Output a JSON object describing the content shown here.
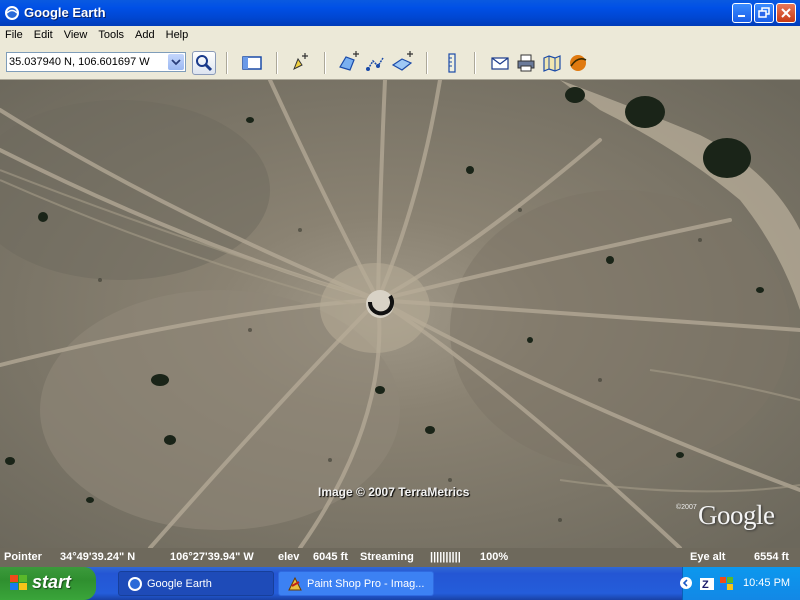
{
  "window": {
    "title": "Google Earth"
  },
  "menu": {
    "items": [
      "File",
      "Edit",
      "View",
      "Tools",
      "Add",
      "Help"
    ]
  },
  "toolbar": {
    "coordinates_value": "35.037940 N, 106.601697 W",
    "icons": [
      "search-icon",
      "sidebar-toggle-icon",
      "placemark-icon",
      "polygon-icon",
      "path-icon",
      "image-overlay-icon",
      "ruler-icon",
      "email-icon",
      "print-icon",
      "google-maps-icon",
      "sky-icon"
    ]
  },
  "map": {
    "credit": "Image © 2007 TerraMetrics",
    "logo_copyright": "©2007",
    "logo": "Google"
  },
  "status_bar": {
    "pointer_label": "Pointer",
    "latitude": "34°49'39.24\" N",
    "longitude": "106°27'39.94\" W",
    "elev_label": "elev",
    "elevation": "6045 ft",
    "streaming_label": "Streaming",
    "streaming_bar": "||||||||||",
    "streaming_percent": "100%",
    "eye_alt_label": "Eye alt",
    "eye_alt_value": "6554 ft"
  },
  "taskbar": {
    "start_label": "start",
    "tasks": [
      {
        "label": "Google Earth",
        "active": true
      },
      {
        "label": "Paint Shop Pro - Imag...",
        "active": false
      }
    ],
    "clock": "10:45 PM"
  },
  "colors": {
    "titlebar": "#0050e6",
    "menubar": "#ece9d8",
    "taskbar": "#245dda",
    "start": "#3c9a3c",
    "status": "#6e695c",
    "terrain": "#7e786b"
  }
}
